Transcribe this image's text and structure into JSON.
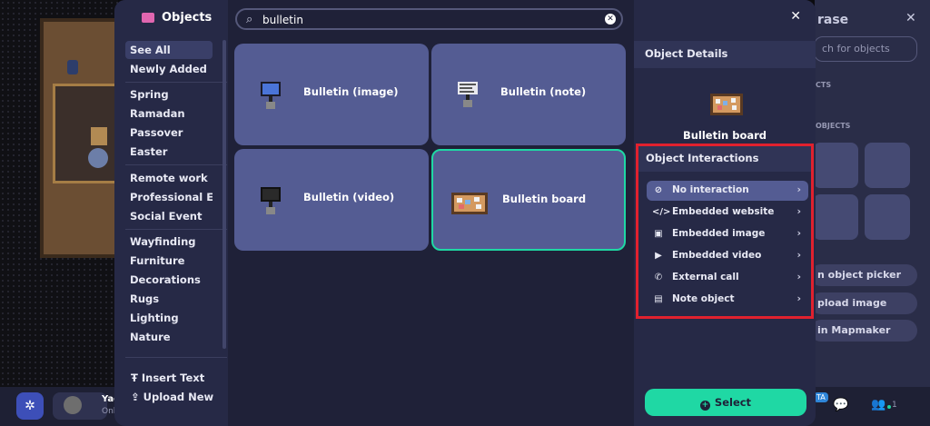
{
  "colors": {
    "accent": "#1fd8a4",
    "highlight_border": "#e0212e",
    "modal_bg": "#1f2138",
    "panel_bg": "#262946",
    "card_bg": "#545c93"
  },
  "sidebar": {
    "title": "Objects",
    "title_icon": "sofa-icon",
    "groups": [
      [
        "See All",
        "Newly Added"
      ],
      [
        "Spring",
        "Ramadan",
        "Passover",
        "Easter"
      ],
      [
        "Remote work",
        "Professional Ev...",
        "Social Event"
      ],
      [
        "Wayfinding",
        "Furniture",
        "Decorations",
        "Rugs",
        "Lighting",
        "Nature"
      ]
    ],
    "active_item": "See All",
    "actions": [
      {
        "label": "Insert Text",
        "icon": "text-icon"
      },
      {
        "label": "Upload New",
        "icon": "upload-icon"
      }
    ]
  },
  "search": {
    "value": "bulletin",
    "icon": "search-icon",
    "clear_icon": "clear-icon"
  },
  "results": [
    {
      "label": "Bulletin (image)",
      "icon": "bulletin-image-icon",
      "selected": false
    },
    {
      "label": "Bulletin (note)",
      "icon": "bulletin-note-icon",
      "selected": false
    },
    {
      "label": "Bulletin (video)",
      "icon": "bulletin-video-icon",
      "selected": false
    },
    {
      "label": "Bulletin board",
      "icon": "bulletin-board-icon",
      "selected": true
    }
  ],
  "details": {
    "header": "Object Details",
    "object_name": "Bulletin board",
    "close_icon": "close-icon",
    "interactions_header": "Object Interactions",
    "interactions": [
      {
        "label": "No interaction",
        "icon": "person-off-icon",
        "active": true
      },
      {
        "label": "Embedded website",
        "icon": "code-icon",
        "active": false
      },
      {
        "label": "Embedded image",
        "icon": "image-icon",
        "active": false
      },
      {
        "label": "Embedded video",
        "icon": "play-icon",
        "active": false
      },
      {
        "label": "External call",
        "icon": "phone-icon",
        "active": false
      },
      {
        "label": "Note object",
        "icon": "note-icon",
        "active": false
      }
    ],
    "select_label": "Select"
  },
  "background_panel": {
    "title_fragment": "rase",
    "search_placeholder_fragment": "ch for objects",
    "section_1": "CTS",
    "section_2": "OBJECTS",
    "buttons": [
      "n object picker",
      "pload image",
      "in Mapmaker"
    ]
  },
  "bottom_bar": {
    "user_name": "Yac",
    "user_status": "Onl",
    "badge": "TA",
    "people_count": "1"
  }
}
